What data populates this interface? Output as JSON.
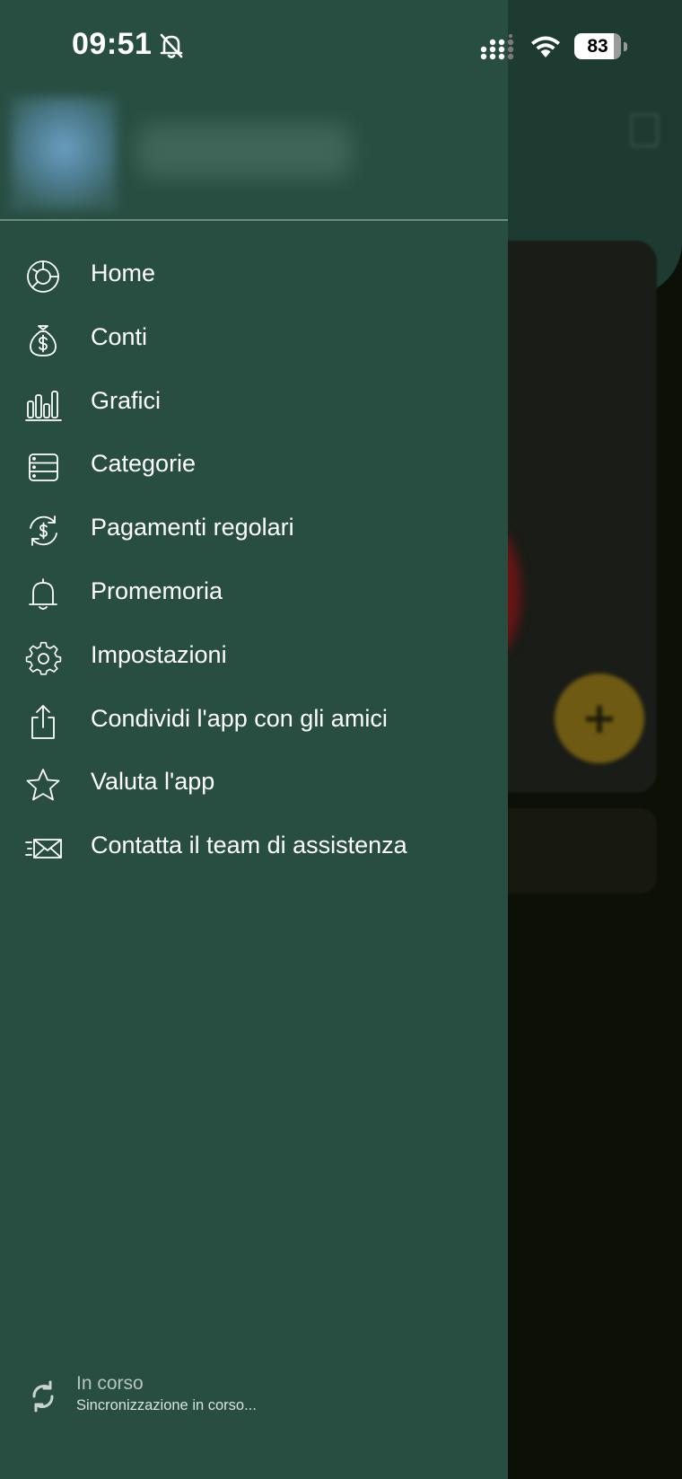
{
  "status_bar": {
    "time": "09:51",
    "battery_level": "83",
    "icons": [
      "bell-off-icon",
      "signal-icon",
      "wifi-icon",
      "battery-icon"
    ]
  },
  "drawer": {
    "menu": [
      {
        "label": "Home",
        "icon": "home-donut-icon"
      },
      {
        "label": "Conti",
        "icon": "money-bag-icon"
      },
      {
        "label": "Grafici",
        "icon": "bar-chart-icon"
      },
      {
        "label": "Categorie",
        "icon": "list-icon"
      },
      {
        "label": "Pagamenti regolari",
        "icon": "recurring-payment-icon"
      },
      {
        "label": "Promemoria",
        "icon": "bell-icon"
      },
      {
        "label": "Impostazioni",
        "icon": "gear-icon"
      },
      {
        "label": "Condividi l'app con gli amici",
        "icon": "share-icon"
      },
      {
        "label": "Valuta l'app",
        "icon": "star-icon"
      },
      {
        "label": "Contatta il team di assistenza",
        "icon": "mail-icon"
      }
    ],
    "sync": {
      "title": "In corso",
      "subtitle": "Sincronizzazione in corso..."
    }
  },
  "colors": {
    "drawer_background": "#284e42",
    "text": "#ffffff",
    "fab": "#e0b722"
  }
}
